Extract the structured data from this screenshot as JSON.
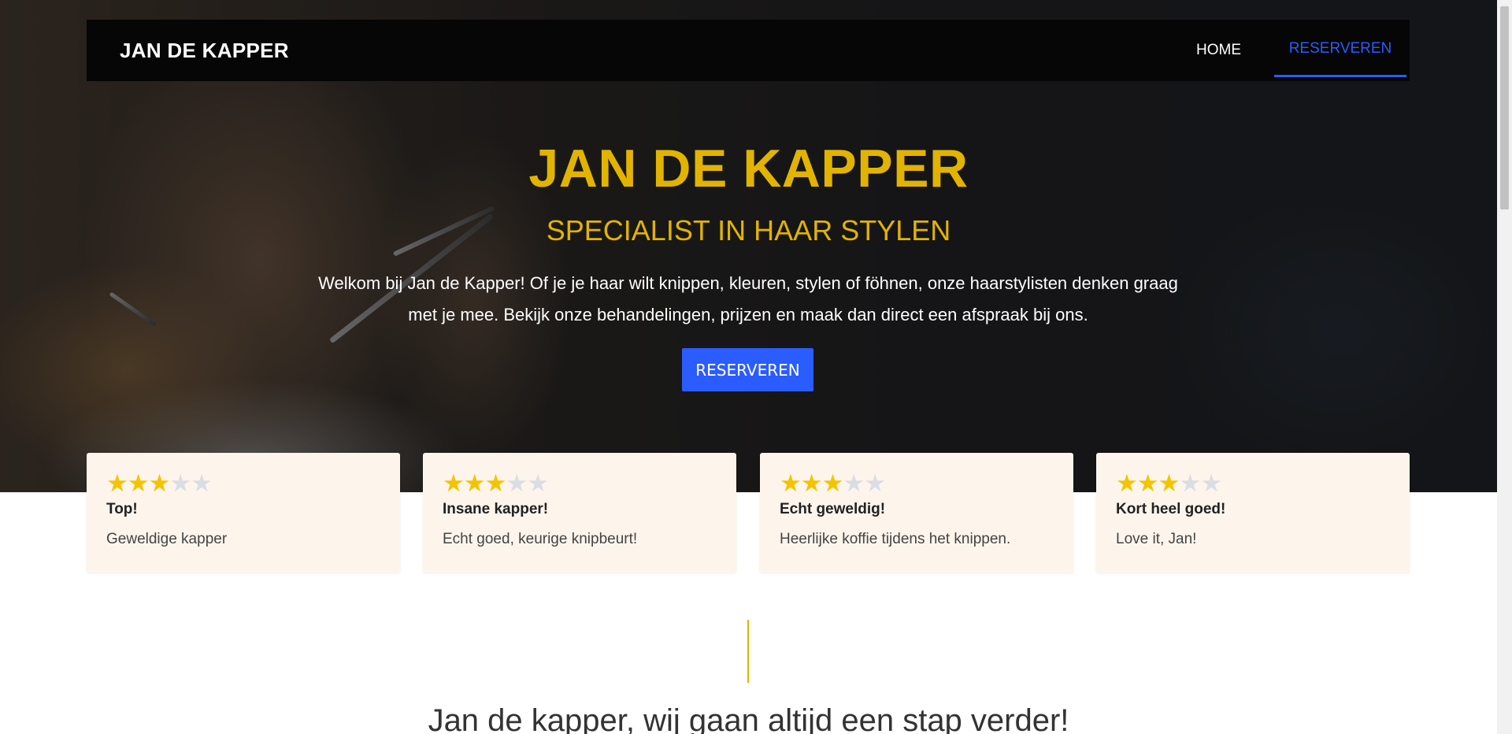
{
  "navbar": {
    "brand": "JAN DE KAPPER",
    "items": [
      {
        "label": "HOME",
        "active": false
      },
      {
        "label": "RESERVEREN",
        "active": true
      }
    ]
  },
  "hero": {
    "title": "JAN DE KAPPER",
    "subtitle": "SPECIALIST IN HAAR STYLEN",
    "text": "Welkom bij Jan de Kapper! Of je je haar wilt knippen, kleuren, stylen of föhnen, onze haarstylisten denken graag met je mee. Bekijk onze behandelingen, prijzen en maak dan direct een afspraak bij ons.",
    "button_label": "RESERVEREN"
  },
  "reviews": [
    {
      "rating": 3,
      "max": 5,
      "title": "Top!",
      "text": "Geweldige kapper"
    },
    {
      "rating": 3,
      "max": 5,
      "title": "Insane kapper!",
      "text": "Echt goed, keurige knipbeurt!"
    },
    {
      "rating": 3,
      "max": 5,
      "title": "Echt geweldig!",
      "text": "Heerlijke koffie tijdens het knippen."
    },
    {
      "rating": 3,
      "max": 5,
      "title": "Kort heel goed!",
      "text": "Love it, Jan!"
    }
  ],
  "tagline": "Jan de kapper, wij gaan altijd een stap verder!",
  "colors": {
    "accent_gold": "#e2b400",
    "primary_blue": "#2a5cff",
    "navbar_bg": "#050605",
    "card_bg": "#fdf5ec",
    "star_on": "#f4c400",
    "star_off": "#dadee3"
  },
  "icons": {
    "star": "star-icon"
  }
}
